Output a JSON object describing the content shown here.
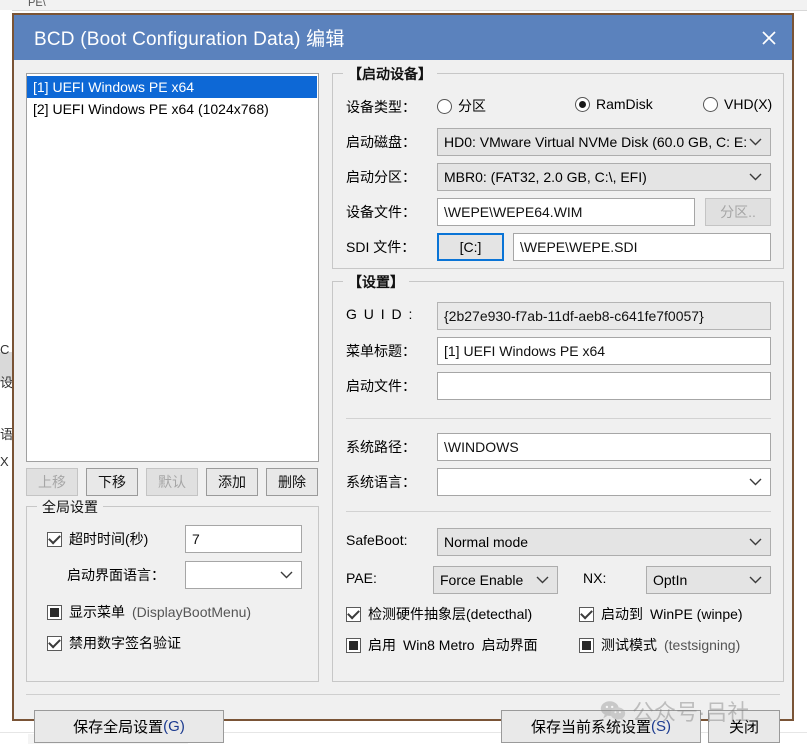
{
  "background": {
    "top_text": "PE\\",
    "left_glyphs": [
      "C",
      "设",
      "语",
      "X"
    ]
  },
  "window": {
    "title": "BCD (Boot Configuration Data) 编辑",
    "close_icon": "close-x-icon"
  },
  "entries": {
    "items": [
      {
        "label": "[1] UEFI Windows PE x64",
        "selected": true
      },
      {
        "label": "[2] UEFI Windows PE x64 (1024x768)",
        "selected": false
      }
    ]
  },
  "entry_buttons": {
    "move_up": "上移",
    "move_down": "下移",
    "default": "默认",
    "add": "添加",
    "remove": "删除"
  },
  "global": {
    "legend": "全局设置",
    "timeout_label": "超时时间(秒)",
    "timeout_value": "7",
    "timeout_checked": true,
    "boot_ui_lang_label": "启动界面语言：",
    "boot_ui_lang_value": "",
    "display_menu_label_main": "显示菜单",
    "display_menu_label_sub": "(DisplayBootMenu)",
    "disable_sig_label": "禁用数字签名验证"
  },
  "device": {
    "legend": "【启动设备】",
    "device_type_label": "设备类型：",
    "device_type_options": [
      "分区",
      "RamDisk",
      "VHD(X)"
    ],
    "device_type_selected": "RamDisk",
    "boot_disk_label": "启动磁盘：",
    "boot_disk_value": "HD0: VMware Virtual NVMe Disk (60.0 GB, C: E:",
    "boot_part_label": "启动分区：",
    "boot_part_value": "MBR0: (FAT32,  2.0 GB, C:\\, EFI)",
    "device_file_label": "设备文件：",
    "device_file_value": "\\WEPE\\WEPE64.WIM",
    "partition_button": "分区..",
    "sdi_label": "SDI 文件：",
    "sdi_drive_button": "[C:]",
    "sdi_value": "\\WEPE\\WEPE.SDI"
  },
  "settings": {
    "legend": "【设置】",
    "guid_label": "G U I D :",
    "guid_value": "{2b27e930-f7ab-11df-aeb8-c641fe7f0057}",
    "menu_title_label": "菜单标题：",
    "menu_title_value": "[1] UEFI Windows PE x64",
    "boot_file_label": "启动文件：",
    "boot_file_value": "",
    "sys_path_label": "系统路径：",
    "sys_path_value": "\\WINDOWS",
    "sys_lang_label": "系统语言：",
    "sys_lang_value": "",
    "safeboot_label": "SafeBoot:",
    "safeboot_value": "Normal mode",
    "pae_label": "PAE:",
    "pae_value": "Force Enable",
    "nx_label": "NX:",
    "nx_value": "OptIn",
    "detecthal_label": "检测硬件抽象层(detecthal)",
    "winpe_label_main": "启动到",
    "winpe_label_sub": "WinPE (winpe)",
    "metro_label_a": "启用",
    "metro_label_b": "Win8 Metro",
    "metro_label_c": "启动界面",
    "testsigning_label_main": "测试模式",
    "testsigning_label_sub": "(testsigning)"
  },
  "footer": {
    "save_global": "保存全局设置",
    "save_global_mn": "(G)",
    "save_current": "保存当前系统设置",
    "save_current_mn": "(S)",
    "close": "关闭"
  },
  "watermark": {
    "text": "公众号·吕社"
  },
  "colors": {
    "titlebar": "#5b82bd",
    "window_border": "#7a5436",
    "selection": "#0d68d6",
    "focus": "#0a74d6",
    "dialog_bg": "#f0f0f0"
  }
}
